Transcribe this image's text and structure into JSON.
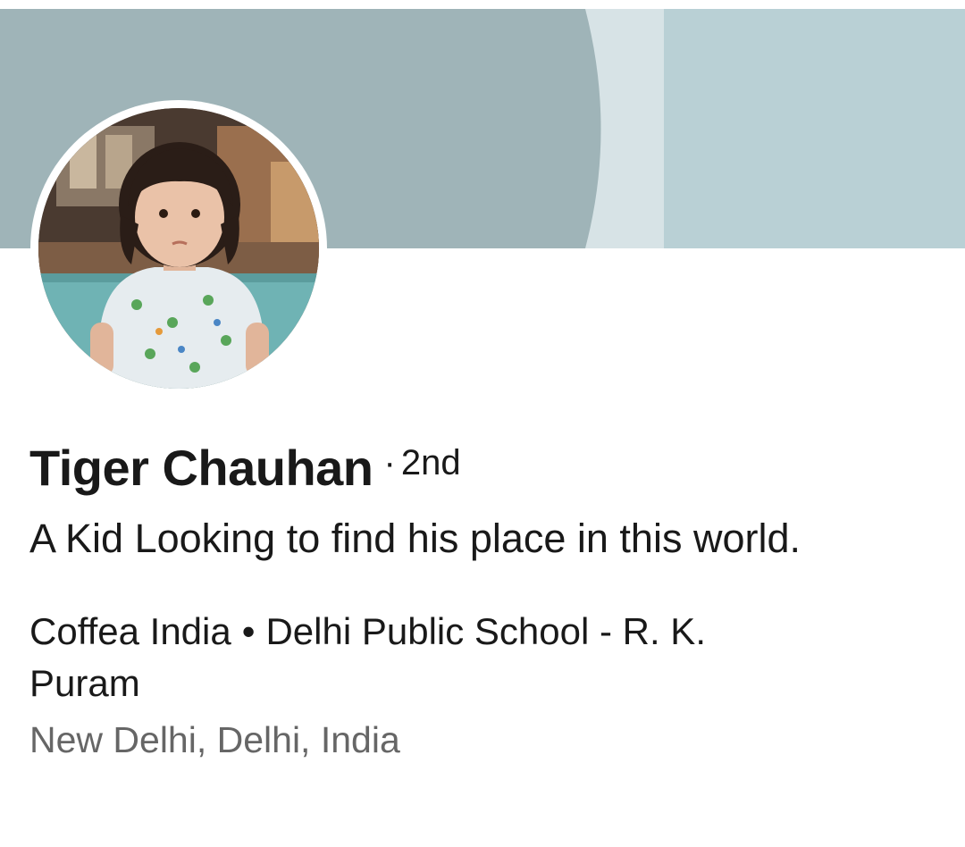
{
  "profile": {
    "name": "Tiger Chauhan",
    "degree": "2nd",
    "degree_separator": "·",
    "headline": "A Kid Looking to find his place in this world.",
    "company": "Coffea India",
    "org_separator": "•",
    "school": "Delhi Public School - R. K. Puram",
    "location": "New Delhi, Delhi, India"
  },
  "colors": {
    "banner_dark": "#9fb4b8",
    "banner_light": "#b9d0d5",
    "banner_highlight": "#d7e3e6",
    "text_primary": "#191919",
    "text_secondary": "#666666"
  },
  "icons": {
    "avatar": "profile-photo"
  }
}
